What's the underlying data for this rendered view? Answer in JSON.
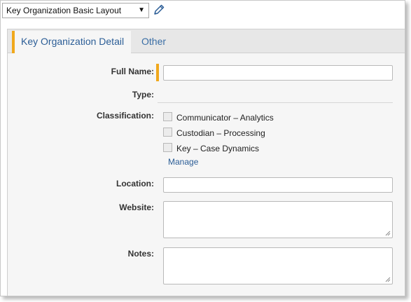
{
  "layout_selector": {
    "value": "Key Organization Basic Layout"
  },
  "tabs": [
    {
      "label": "Key Organization Detail"
    },
    {
      "label": "Other"
    }
  ],
  "form": {
    "full_name_label": "Full Name:",
    "type_label": "Type:",
    "classification_label": "Classification:",
    "classification_options": [
      {
        "label": "Communicator – Analytics",
        "checked": false
      },
      {
        "label": "Custodian – Processing",
        "checked": false
      },
      {
        "label": "Key –  Case Dynamics",
        "checked": false
      }
    ],
    "manage_link": "Manage",
    "location_label": "Location:",
    "website_label": "Website:",
    "notes_label": "Notes:"
  },
  "colors": {
    "accent": "#f0a81c",
    "link": "#2b5d96"
  }
}
